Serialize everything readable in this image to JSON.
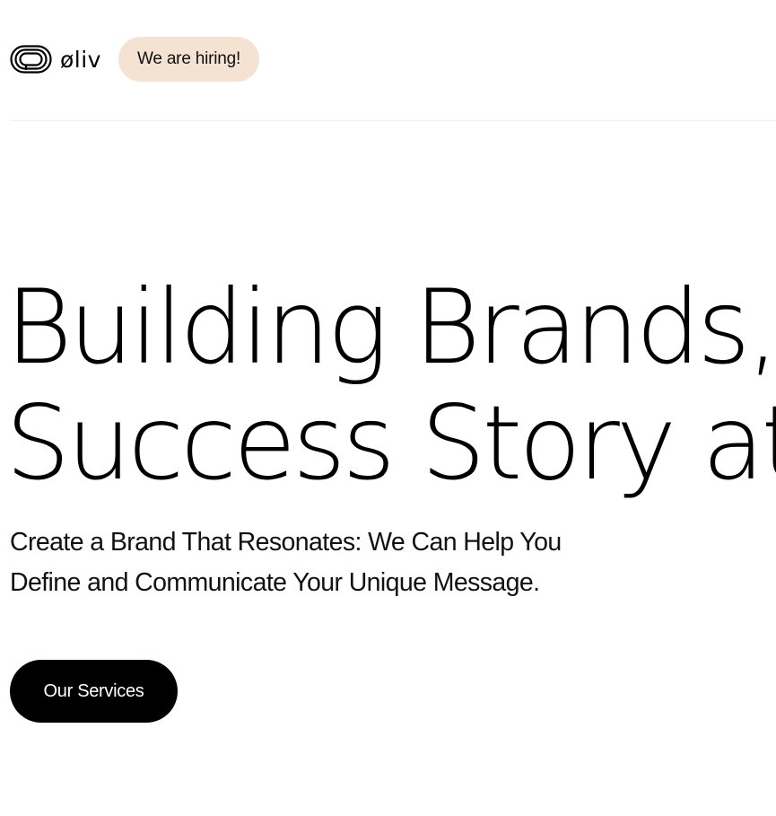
{
  "header": {
    "logo": {
      "icon": "oliv-logo-icon",
      "brand_name": "øliv"
    },
    "hiring_badge": {
      "label": "We are hiring!",
      "color": "#f4e3d3"
    }
  },
  "hero": {
    "title_lines": [
      "Building Brands,",
      "Success Story at"
    ],
    "subtitle_lines": [
      "Create a Brand That Resonates: We Can Help You",
      "Define and Communicate Your Unique Message."
    ],
    "cta": {
      "label": "Our Services",
      "color": "#000000"
    }
  }
}
